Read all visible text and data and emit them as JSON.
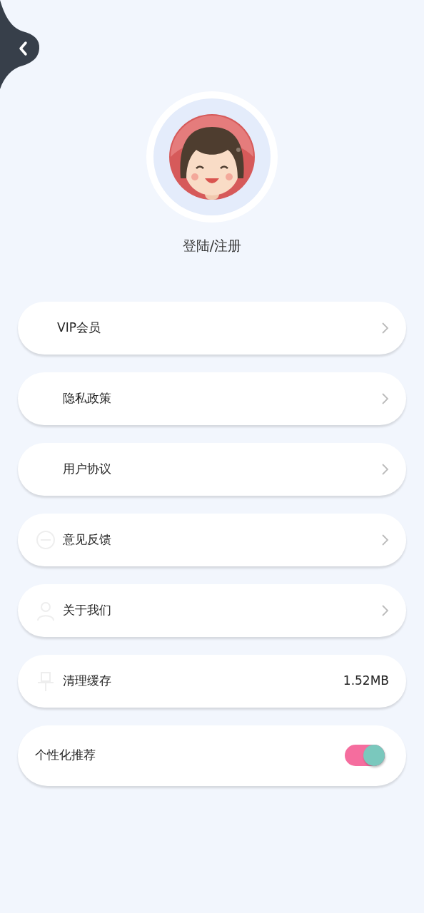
{
  "header": {
    "login_label": "登陆/注册"
  },
  "menu": [
    {
      "kind": "link",
      "label": "VIP会员"
    },
    {
      "kind": "link",
      "label": "隐私政策"
    },
    {
      "kind": "link",
      "label": "用户协议"
    },
    {
      "kind": "link",
      "label": "意见反馈"
    },
    {
      "kind": "link",
      "label": "关于我们"
    },
    {
      "kind": "value",
      "label": "清理缓存",
      "value": "1.52MB"
    },
    {
      "kind": "toggle",
      "label": "个性化推荐",
      "on": true
    }
  ]
}
